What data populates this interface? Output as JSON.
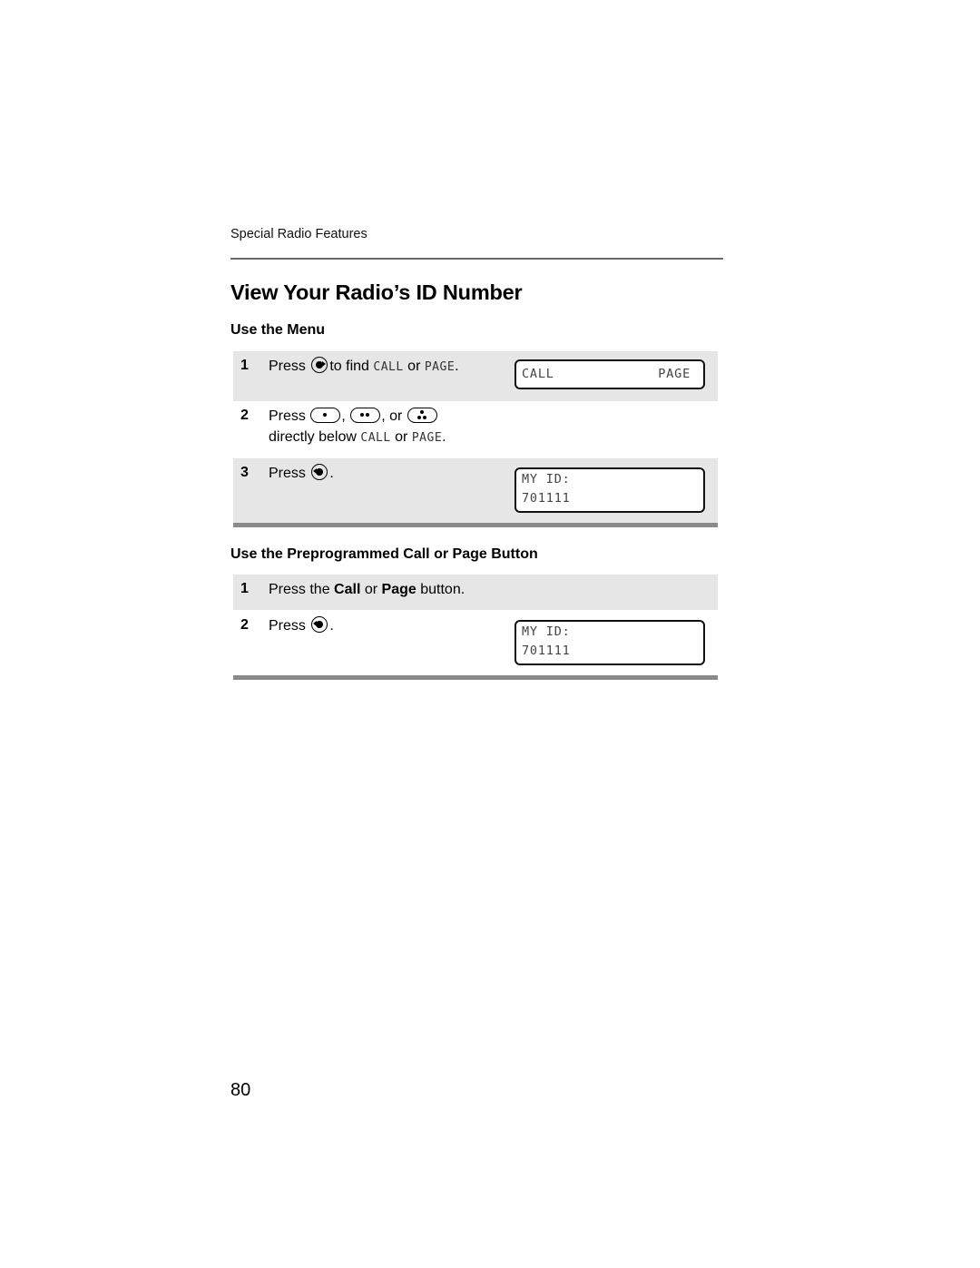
{
  "header": {
    "section": "Special Radio Features"
  },
  "title": "View Your Radio’s ID Number",
  "menu_section": {
    "heading": "Use the Menu",
    "steps": [
      {
        "number": "1",
        "press": "Press",
        "text_after_icon": "to find",
        "option_a": "CALL",
        "or": "or",
        "option_b": "PAGE",
        "period": ".",
        "icon": "right-arrow-button-icon",
        "display": {
          "left": "CALL",
          "right": "PAGE"
        }
      },
      {
        "number": "2",
        "press": "Press",
        "comma1": ",",
        "comma_or": ", or",
        "line2_prefix": "directly below",
        "option_a": "CALL",
        "or": "or",
        "option_b": "PAGE",
        "period": ".",
        "icons": [
          "one-dot-softkey-icon",
          "two-dot-softkey-icon",
          "three-dot-softkey-icon"
        ]
      },
      {
        "number": "3",
        "press": "Press",
        "period": ".",
        "icon": "left-arrow-button-icon",
        "display": {
          "line1": "MY ID:",
          "line2": "701111"
        }
      }
    ]
  },
  "button_section": {
    "heading": "Use the Preprogrammed Call or Page Button",
    "steps": [
      {
        "number": "1",
        "prefix": "Press the",
        "call": "Call",
        "or": "or",
        "page": "Page",
        "suffix": "button."
      },
      {
        "number": "2",
        "press": "Press",
        "period": ".",
        "icon": "left-arrow-button-icon",
        "display": {
          "line1": "MY ID:",
          "line2": "701111"
        }
      }
    ]
  },
  "page_number": "80"
}
